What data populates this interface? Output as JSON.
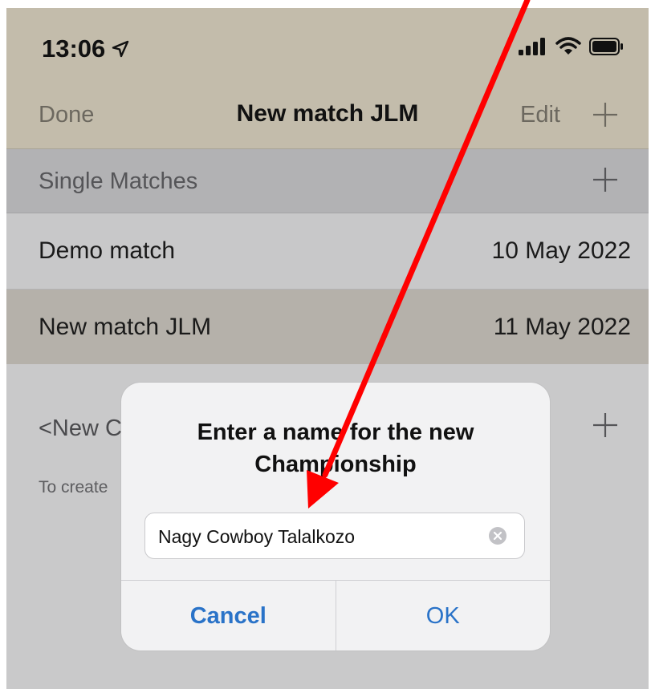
{
  "status_bar": {
    "time": "13:06",
    "icons": [
      "location-arrow-icon",
      "signal-icon",
      "wifi-icon",
      "battery-icon"
    ]
  },
  "nav": {
    "left_label": "Done",
    "title": "New match JLM",
    "edit_label": "Edit",
    "add_icon": "plus-icon"
  },
  "section": {
    "title": "Single Matches",
    "add_icon": "plus-icon"
  },
  "matches": [
    {
      "name": "Demo match",
      "date": "10 May 2022",
      "selected": false
    },
    {
      "name": "New match JLM",
      "date": "11 May 2022",
      "selected": true
    }
  ],
  "championship": {
    "label": "<New C",
    "hint": "To create",
    "add_icon": "plus-icon"
  },
  "alert": {
    "title_line1": "Enter a name for the new",
    "title_line2": "Championship",
    "input_value": "Nagy Cowboy Talalkozo",
    "clear_icon": "clear-circle-icon",
    "cancel_label": "Cancel",
    "ok_label": "OK"
  },
  "colors": {
    "accent": "#2a73c8",
    "nav_background": "#c3bcab",
    "annotation_arrow": "#ff0000"
  }
}
